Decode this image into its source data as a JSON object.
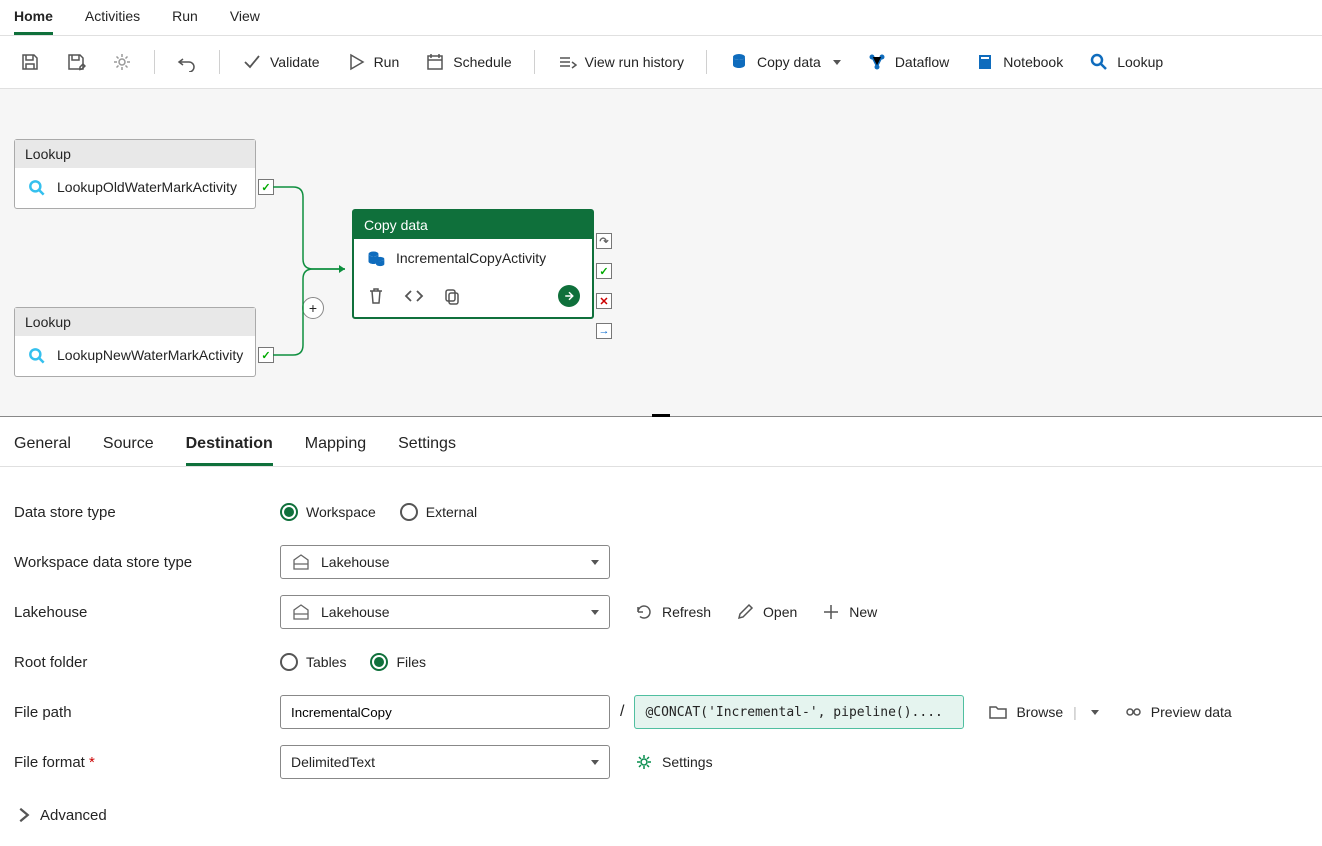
{
  "ribbon_tabs": {
    "home": "Home",
    "activities": "Activities",
    "run": "Run",
    "view": "View"
  },
  "toolbar": {
    "validate": "Validate",
    "run": "Run",
    "schedule": "Schedule",
    "history": "View run history",
    "copydata": "Copy data",
    "dataflow": "Dataflow",
    "notebook": "Notebook",
    "lookup": "Lookup"
  },
  "canvas": {
    "lookup_type": "Lookup",
    "lookup1_title": "LookupOldWaterMarkActivity",
    "lookup2_title": "LookupNewWaterMarkActivity",
    "copy_type": "Copy data",
    "copy_title": "IncrementalCopyActivity"
  },
  "details_tabs": {
    "general": "General",
    "source": "Source",
    "destination": "Destination",
    "mapping": "Mapping",
    "settings": "Settings"
  },
  "form": {
    "data_store_type": "Data store type",
    "workspace": "Workspace",
    "external": "External",
    "ws_store_type": "Workspace data store type",
    "lakehouse_label": "Lakehouse",
    "lakehouse_value": "Lakehouse",
    "lakehouse_field": "Lakehouse",
    "refresh": "Refresh",
    "open": "Open",
    "new": "New",
    "root_folder": "Root folder",
    "tables": "Tables",
    "files": "Files",
    "file_path": "File path",
    "file_path_value": "IncrementalCopy",
    "file_path_expr": "@CONCAT('Incremental-', pipeline()....",
    "browse": "Browse",
    "preview": "Preview data",
    "file_format": "File format",
    "file_format_value": "DelimitedText",
    "settings_btn": "Settings",
    "advanced": "Advanced"
  }
}
